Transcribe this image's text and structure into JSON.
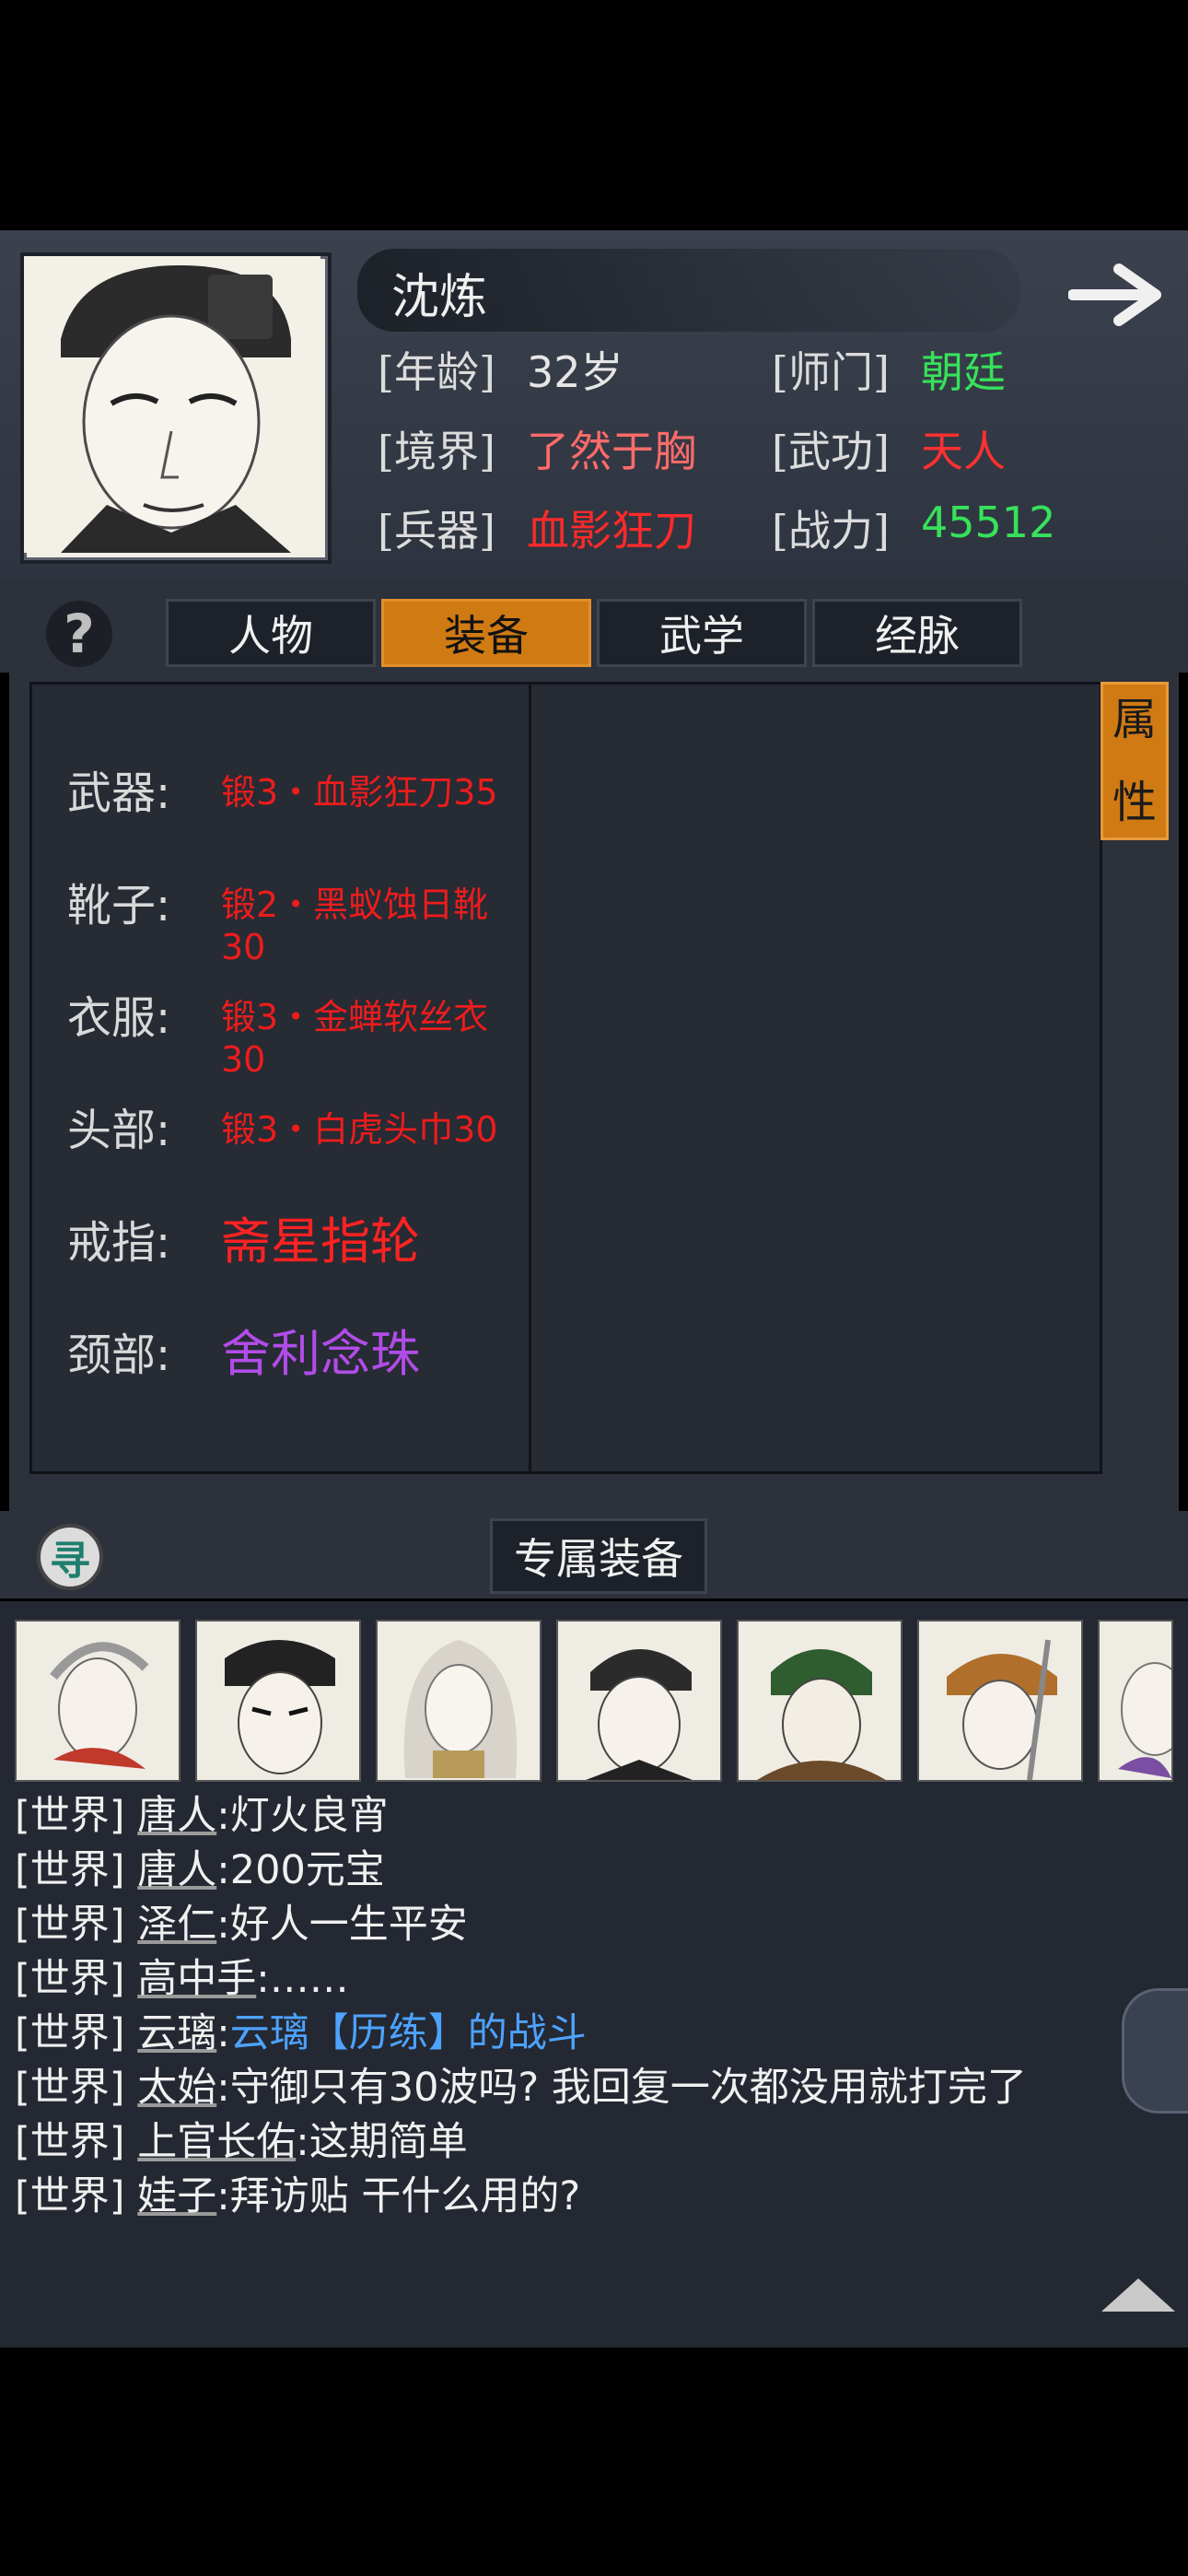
{
  "character": {
    "name": "沈炼",
    "stats": [
      {
        "label": "[年龄]",
        "value": "32岁",
        "color": "#e6e6e6"
      },
      {
        "label": "[师门]",
        "value": "朝廷",
        "color": "#36e25a"
      },
      {
        "label": "[境界]",
        "value": "了然于胸",
        "color": "#ff6b6b"
      },
      {
        "label": "[武功]",
        "value": "天人",
        "color": "#ff3030"
      },
      {
        "label": "[兵器]",
        "value": "血影狂刀",
        "color": "#ff2a2a"
      },
      {
        "label": "[战力]",
        "value": "45512",
        "color": "#36e25a"
      }
    ]
  },
  "tabs": {
    "help": "?",
    "items": [
      "人物",
      "装备",
      "武学",
      "经脉"
    ],
    "active": "装备"
  },
  "equipment": {
    "slots": [
      {
        "label": "武器:",
        "value": "锻3・血影狂刀35",
        "color": "#ee1c1c",
        "size": "sm"
      },
      {
        "label": "靴子:",
        "value": "锻2・黑蚁蚀日靴30",
        "color": "#ee1c1c",
        "size": "sm"
      },
      {
        "label": "衣服:",
        "value": "锻3・金蝉软丝衣30",
        "color": "#ee1c1c",
        "size": "sm"
      },
      {
        "label": "头部:",
        "value": "锻3・白虎头巾30",
        "color": "#ee1c1c",
        "size": "sm"
      },
      {
        "label": "戒指:",
        "value": "斋星指轮",
        "color": "#ff2222",
        "size": "lg"
      },
      {
        "label": "颈部:",
        "value": "舍利念珠",
        "color": "#b24ce8",
        "size": "lg"
      }
    ],
    "attr_button": [
      "属",
      "性"
    ],
    "exclusive_label": "专属装备",
    "seek_icon": "寻"
  },
  "chat": {
    "messages": [
      {
        "channel": "[世界]",
        "user": "唐人",
        "text": ":灯火良宵"
      },
      {
        "channel": "[世界]",
        "user": "唐人",
        "text": ":200元宝"
      },
      {
        "channel": "[世界]",
        "user": "泽仁",
        "text": ":好人一生平安"
      },
      {
        "channel": "[世界]",
        "user": "高中手",
        "text": ":……"
      },
      {
        "channel": "[世界]",
        "user": "云璃",
        "text": ":",
        "link": "云璃【历练】的战斗"
      },
      {
        "channel": "[世界]",
        "user": "太始",
        "text": ":守御只有30波吗? 我回复一次都没用就打完了"
      },
      {
        "channel": "[世界]",
        "user": "上官长佑",
        "text": ":这期简单"
      },
      {
        "channel": "[世界]",
        "user": "娃子",
        "text": ":拜访贴 干什么用的?"
      }
    ]
  }
}
